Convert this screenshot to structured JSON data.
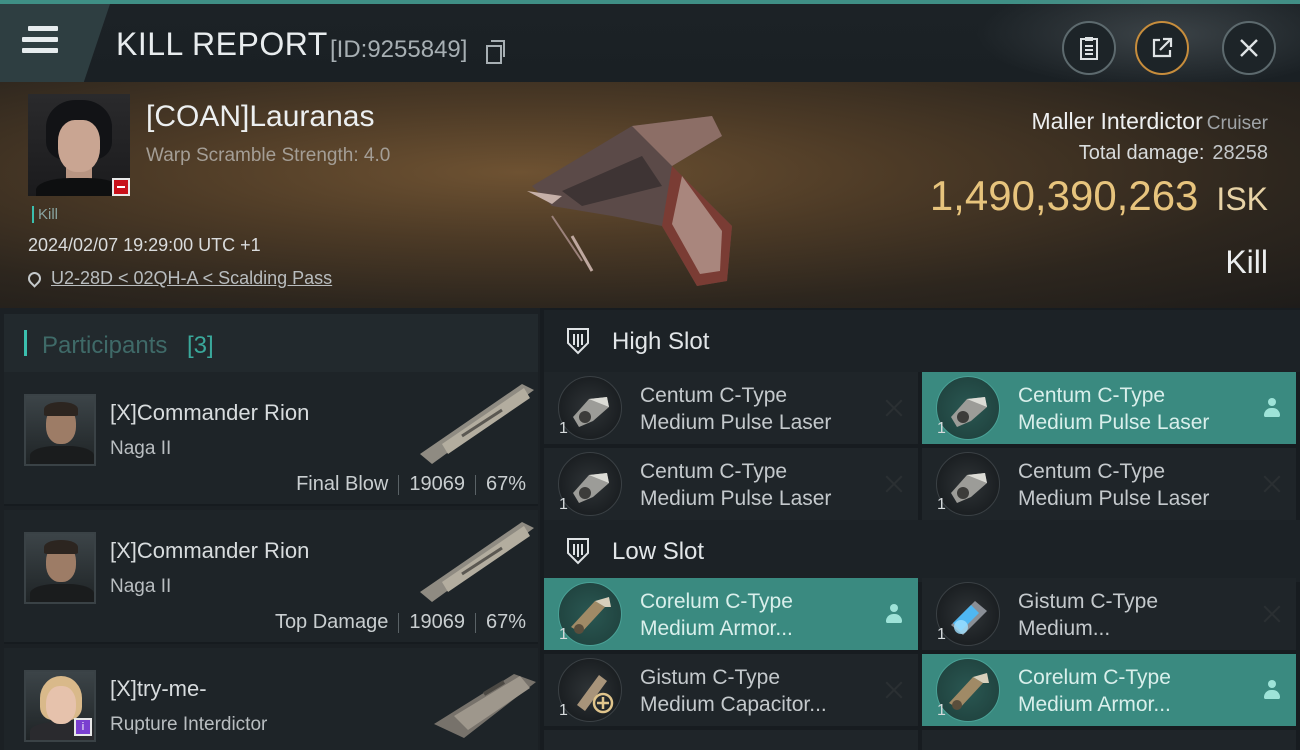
{
  "header": {
    "title": "KILL REPORT",
    "report_id": "[ID:9255849]"
  },
  "victim": {
    "name": "[COAN]Lauranas",
    "warp_scramble": "Warp Scramble Strength: 4.0",
    "kill_tag": "Kill",
    "datetime": "2024/02/07 19:29:00 UTC +1",
    "location": "U2-28D < 02QH-A < Scalding Pass",
    "ship_name": "Maller Interdictor",
    "ship_class": "Cruiser",
    "total_damage_label": "Total damage:",
    "total_damage": "28258",
    "isk_value": "1,490,390,263",
    "isk_unit": "ISK",
    "result": "Kill"
  },
  "participants": {
    "title": "Participants",
    "count": "[3]",
    "items": [
      {
        "name": "[X]Commander Rion",
        "ship": "Naga II",
        "role": "Final Blow",
        "damage": "19069",
        "percent": "67%"
      },
      {
        "name": "[X]Commander Rion",
        "ship": "Naga II",
        "role": "Top Damage",
        "damage": "19069",
        "percent": "67%"
      },
      {
        "name": "[X]try-me-",
        "ship": "Rupture Interdictor",
        "role": "",
        "damage": "",
        "percent": ""
      }
    ]
  },
  "fitting": {
    "high_slot": {
      "title": "High Slot",
      "modules": [
        {
          "qty": "1",
          "line1": "Centum C-Type",
          "line2": "Medium Pulse Laser",
          "action": "close-icon",
          "active": false
        },
        {
          "qty": "1",
          "line1": "Centum C-Type",
          "line2": "Medium Pulse Laser",
          "action": "person-icon",
          "active": true
        },
        {
          "qty": "1",
          "line1": "Centum C-Type",
          "line2": "Medium Pulse Laser",
          "action": "close-icon",
          "active": false
        },
        {
          "qty": "1",
          "line1": "Centum C-Type",
          "line2": "Medium Pulse Laser",
          "action": "close-icon",
          "active": false
        }
      ]
    },
    "low_slot": {
      "title": "Low Slot",
      "modules": [
        {
          "qty": "1",
          "line1": "Corelum C-Type",
          "line2": "Medium Armor...",
          "action": "person-icon",
          "active": true
        },
        {
          "qty": "1",
          "line1": "Gistum C-Type",
          "line2": "Medium...",
          "action": "close-icon",
          "active": false
        },
        {
          "qty": "1",
          "line1": "Gistum C-Type",
          "line2": "Medium Capacitor...",
          "action": "close-icon",
          "active": false
        },
        {
          "qty": "1",
          "line1": "Corelum C-Type",
          "line2": "Medium Armor...",
          "action": "person-icon",
          "active": true
        }
      ]
    }
  },
  "colors": {
    "accent_teal": "#3a8a80",
    "isk_gold": "#e7c47d",
    "close_button_ring": "#c78d3c"
  }
}
